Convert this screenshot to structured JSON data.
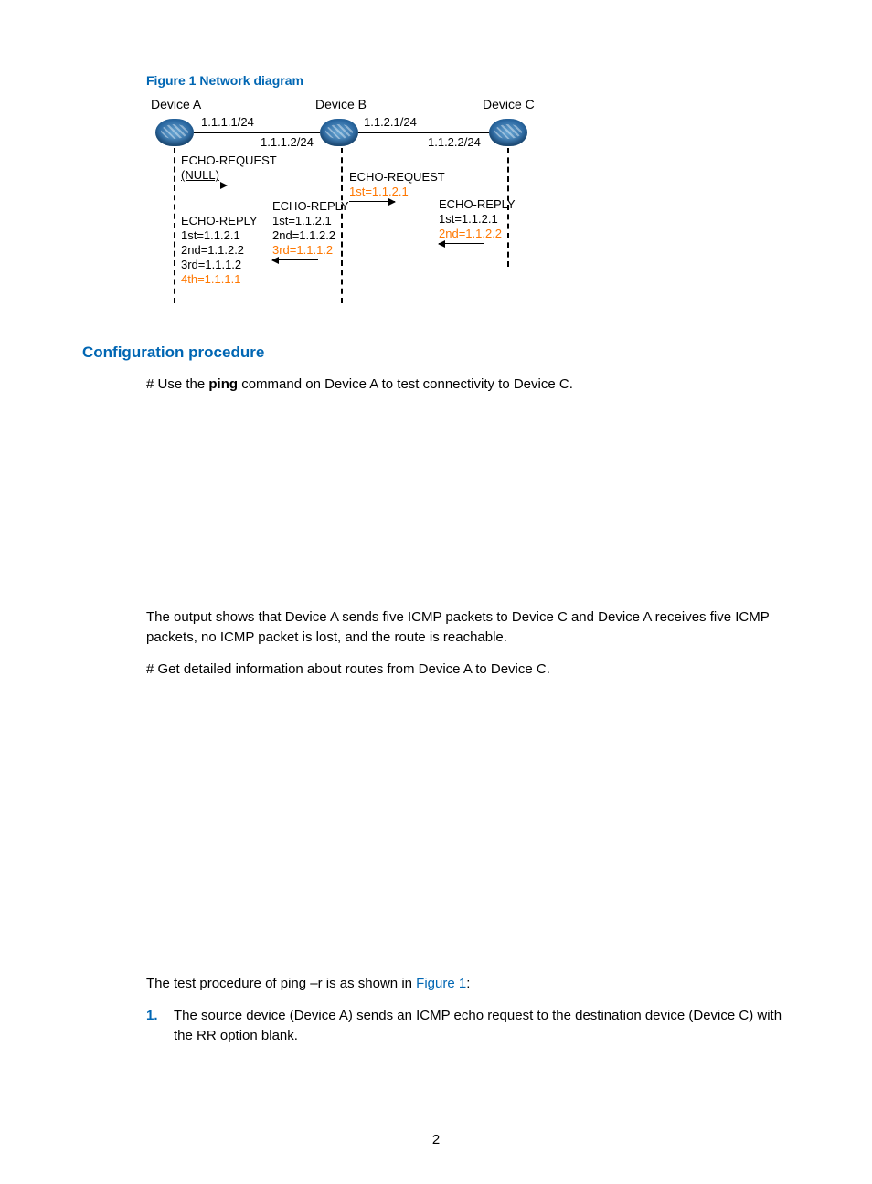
{
  "figure": {
    "caption": "Figure 1 Network diagram",
    "devices": {
      "a": "Device A",
      "b": "Device B",
      "c": "Device C"
    },
    "ips": {
      "a_right": "1.1.1.1/24",
      "b_left": "1.1.1.2/24",
      "b_right": "1.1.2.1/24",
      "c_left": "1.1.2.2/24"
    },
    "annoA": {
      "req1": "ECHO-REQUEST",
      "req2": "(NULL)",
      "rep1": "ECHO-REPLY",
      "rep2": "1st=1.1.2.1",
      "rep3": "2nd=1.1.2.2",
      "rep4": "3rd=1.1.1.2",
      "rep5": "4th=1.1.1.1"
    },
    "annoB": {
      "req1": "ECHO-REQUEST",
      "req2": "1st=1.1.2.1",
      "rep1": "ECHO-REPLY",
      "rep2": "1st=1.1.2.1",
      "rep3": "2nd=1.1.2.2",
      "rep4": "3rd=1.1.1.2"
    },
    "annoC": {
      "rep1": "ECHO-REPLY",
      "rep2": "1st=1.1.2.1",
      "rep3": "2nd=1.1.2.2"
    }
  },
  "section1": {
    "heading": "Configuration procedure",
    "line1a": "# Use the ",
    "line1b": "ping",
    "line1c": " command on Device A to test connectivity to Device C."
  },
  "para1": "The output shows that Device A sends five ICMP packets to Device C and Device A receives five ICMP packets, no ICMP packet is lost, and the route is reachable.",
  "para2": "# Get detailed information about routes from Device A to Device C.",
  "para3a": "The test procedure of ping –r is as shown in ",
  "para3b": "Figure 1",
  "para3c": ":",
  "list1": {
    "num": "1.",
    "text": "The source device (Device A) sends an ICMP echo request to the destination device (Device C) with the RR option blank."
  },
  "pagenum": "2"
}
